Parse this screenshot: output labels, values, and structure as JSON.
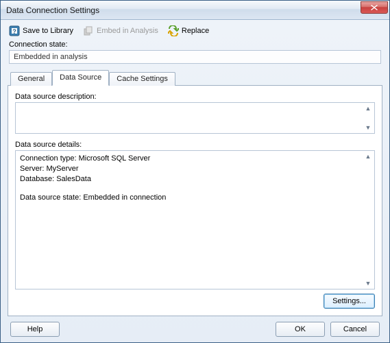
{
  "window": {
    "title": "Data Connection Settings"
  },
  "toolbar": {
    "save_to_library": "Save to Library",
    "embed_in_analysis": "Embed in Analysis",
    "replace": "Replace"
  },
  "connection_state": {
    "label": "Connection state:",
    "value": "Embedded in analysis"
  },
  "tabs": {
    "general": "General",
    "data_source": "Data Source",
    "cache_settings": "Cache Settings",
    "active": "data_source"
  },
  "data_source_panel": {
    "description_label": "Data source description:",
    "description_value": "",
    "details_label": "Data source details:",
    "details_lines": {
      "line1": "Connection type: Microsoft SQL Server",
      "line2": "Server: MyServer",
      "line3": "Database: SalesData",
      "line4": "Data source state: Embedded in connection"
    },
    "settings_button": "Settings..."
  },
  "footer": {
    "help": "Help",
    "ok": "OK",
    "cancel": "Cancel"
  }
}
